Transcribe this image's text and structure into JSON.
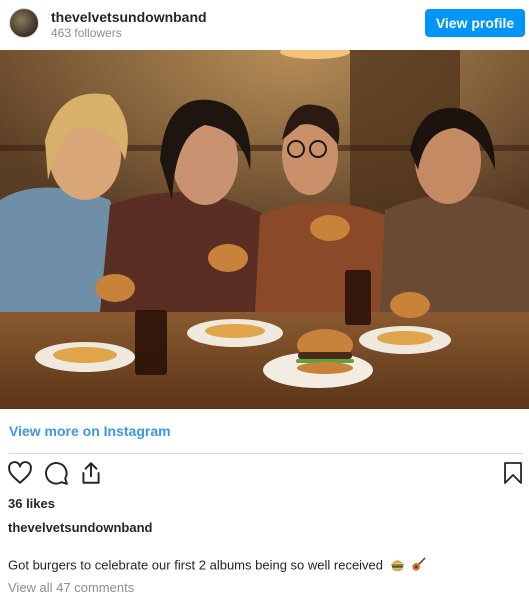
{
  "header": {
    "username": "thevelvetsundownband",
    "followers": "463 followers",
    "view_profile_label": "View profile"
  },
  "post": {
    "view_more_label": "View more on Instagram",
    "likes": "36 likes",
    "caption_username": "thevelvetsundownband",
    "caption_text": "Got burgers to celebrate our first 2 albums being so well received",
    "caption_emojis": [
      "burger-emoji",
      "guitar-emoji"
    ],
    "comments_link": "View all 47 comments"
  },
  "colors": {
    "accent": "#0095f6",
    "link": "#3897f0",
    "text": "#262626",
    "muted": "#8e8e8e",
    "divider": "#dbdbdb"
  },
  "icons": [
    "heart-icon",
    "comment-icon",
    "share-icon",
    "bookmark-icon"
  ]
}
